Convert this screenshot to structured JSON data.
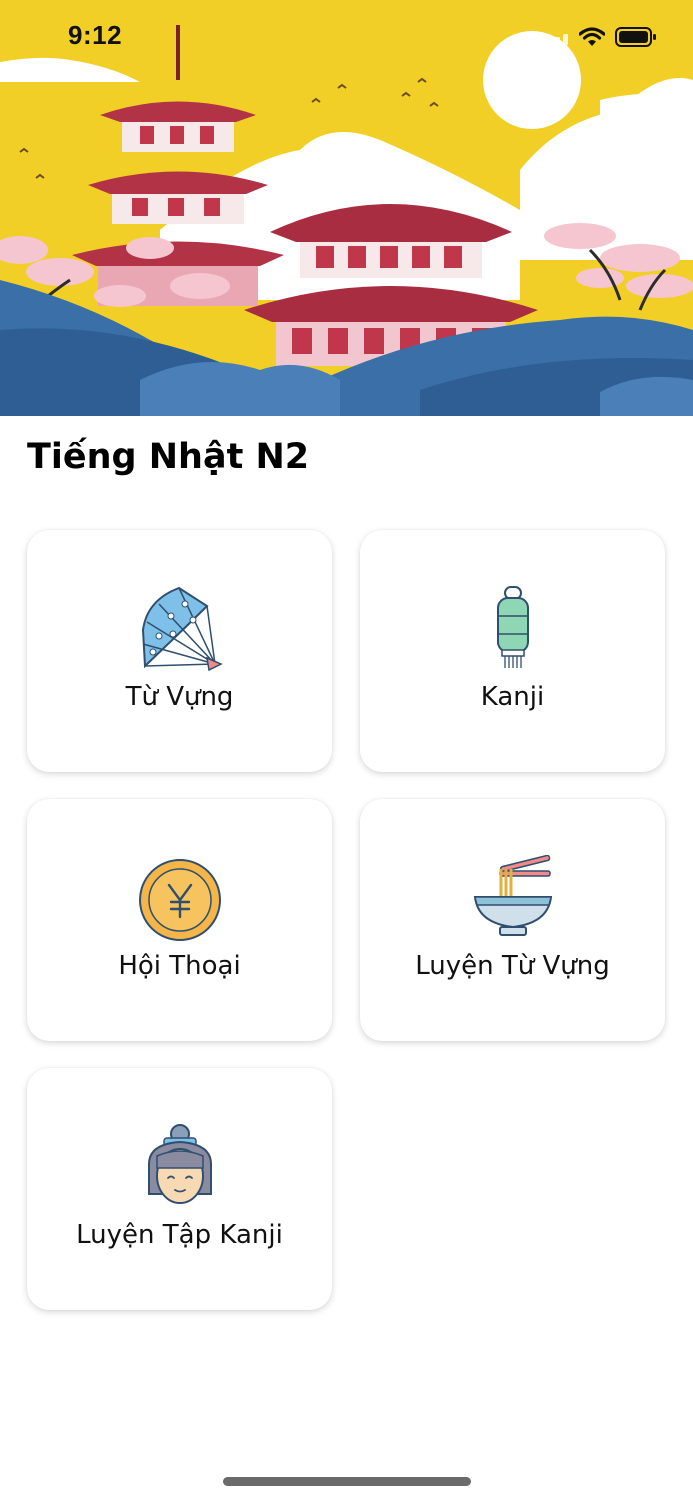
{
  "status_bar": {
    "time": "9:12"
  },
  "page": {
    "title": "Tiếng Nhật N2"
  },
  "menu": [
    {
      "id": "tu-vung",
      "label": "Từ Vựng",
      "icon": "fan-icon"
    },
    {
      "id": "kanji",
      "label": "Kanji",
      "icon": "lantern-icon"
    },
    {
      "id": "hoi-thoai",
      "label": "Hội Thoại",
      "icon": "yen-coin-icon"
    },
    {
      "id": "luyen-tu-vung",
      "label": "Luyện Từ Vựng",
      "icon": "noodle-bowl-icon"
    },
    {
      "id": "luyen-tap-kanji",
      "label": "Luyện Tập Kanji",
      "icon": "geisha-icon"
    }
  ],
  "colors": {
    "hero_yellow": "#f2cf26",
    "pagoda_red": "#c0364a",
    "hills_blue": "#3a6fa8",
    "blossom_pink": "#f6c6d0"
  }
}
